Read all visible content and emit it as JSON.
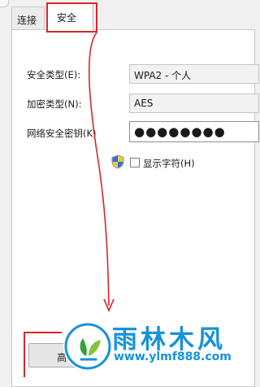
{
  "tabs": [
    {
      "label": "连接"
    },
    {
      "label": "安全"
    }
  ],
  "form": {
    "security_type": {
      "label": "安全类型(E):",
      "value": "WPA2 - 个人"
    },
    "encryption_type": {
      "label": "加密类型(N):",
      "value": "AES"
    },
    "network_key": {
      "label": "网络安全密钥(K)",
      "value": "●●●●●●●●"
    },
    "show_characters": {
      "label": "显示字符(H)",
      "checked": false
    }
  },
  "footer": {
    "button_label": "高"
  },
  "watermark": {
    "brand": "雨林木风",
    "url": "www.ylmf888.com"
  },
  "colors": {
    "annotation_red": "#d7262b",
    "watermark_blue": "#1593d8"
  }
}
